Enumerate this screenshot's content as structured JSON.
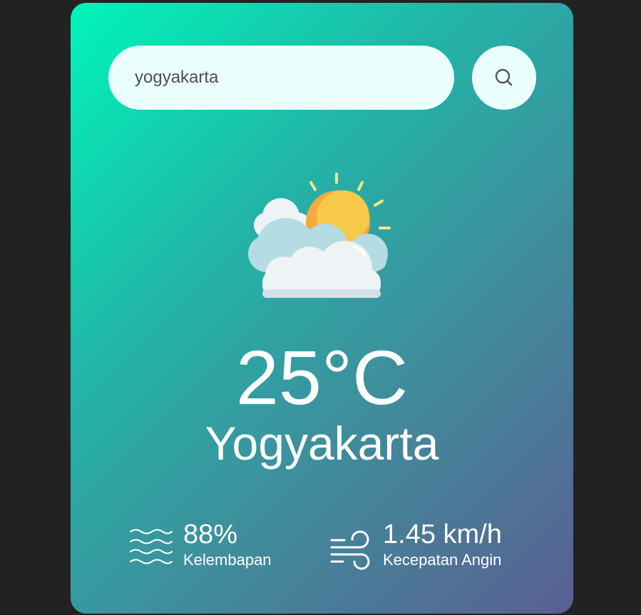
{
  "search": {
    "value": "yogyakarta",
    "button_icon": "search-icon"
  },
  "weather": {
    "icon": "partly-cloudy-icon",
    "temperature": "25°C",
    "city": "Yogyakarta"
  },
  "details": {
    "humidity": {
      "icon": "waves-icon",
      "value": "88%",
      "label": "Kelembapan"
    },
    "wind": {
      "icon": "wind-icon",
      "value": "1.45 km/h",
      "label": "Kecepatan Angin"
    }
  },
  "colors": {
    "background": "#222222",
    "gradient_start": "#00f5b9",
    "gradient_end": "#5a5f91",
    "input_background": "#eafffc",
    "text": "#ffffff"
  }
}
